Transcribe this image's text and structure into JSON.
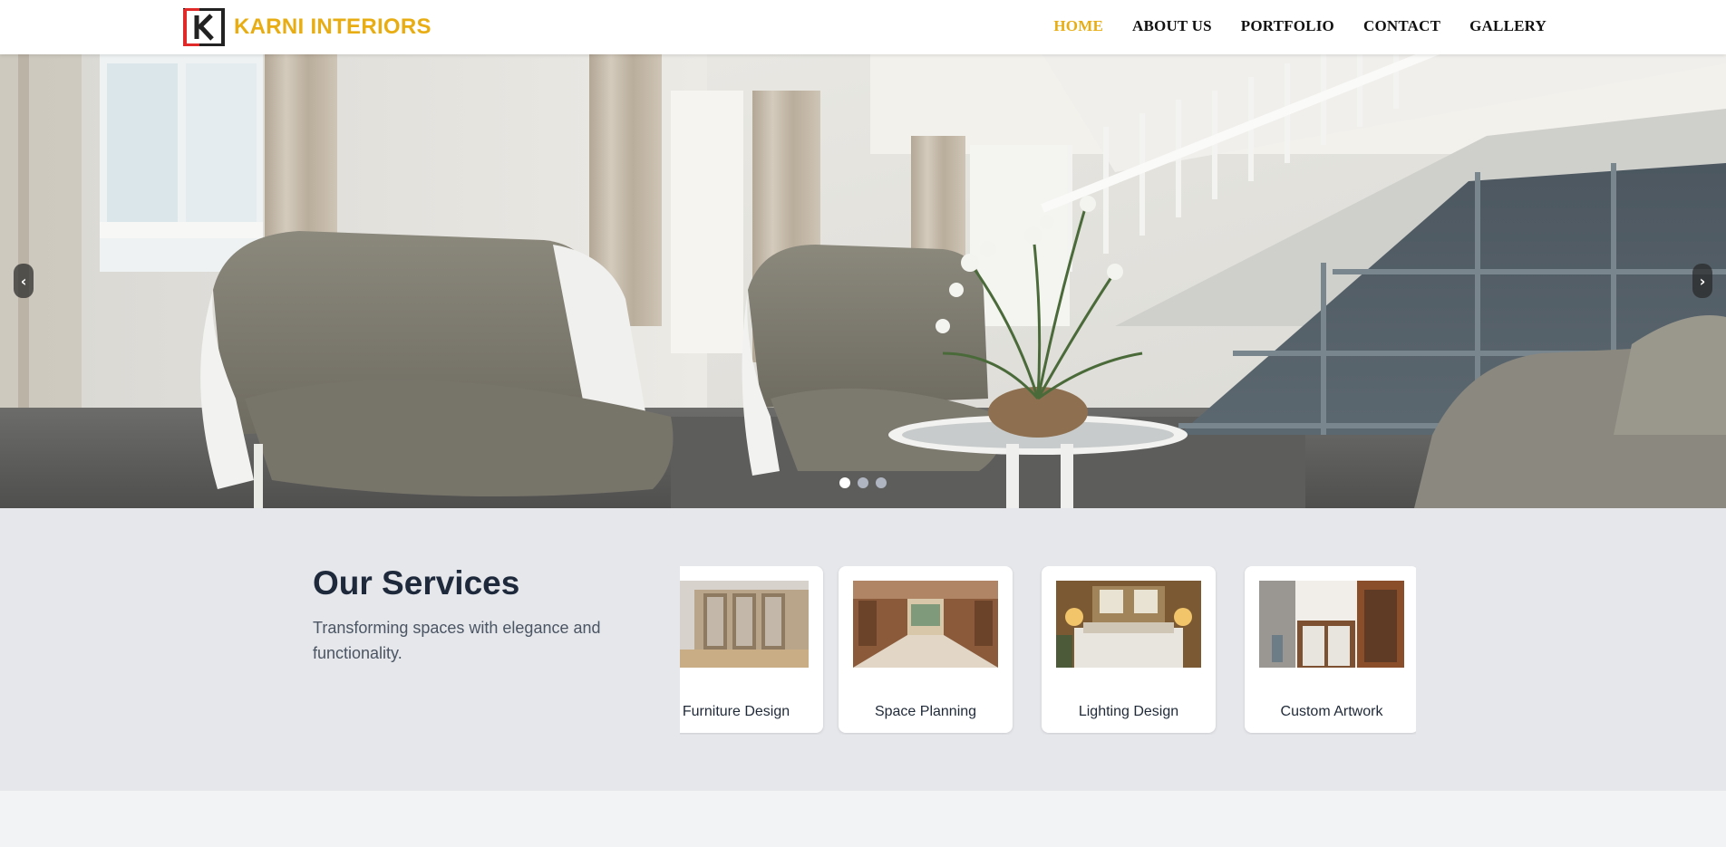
{
  "brand": {
    "name": "KARNI INTERIORS",
    "logo_icon": "k-logo-icon"
  },
  "nav": {
    "items": [
      {
        "label": "HOME",
        "active": true
      },
      {
        "label": "ABOUT US",
        "active": false
      },
      {
        "label": "PORTFOLIO",
        "active": false
      },
      {
        "label": "CONTACT",
        "active": false
      },
      {
        "label": "GALLERY",
        "active": false
      }
    ]
  },
  "hero": {
    "prev_label": "‹",
    "next_label": "›",
    "slide_count": 3,
    "active_slide": 1
  },
  "services": {
    "title": "Our Services",
    "subtitle": "Transforming spaces with elegance and functionality.",
    "cards": [
      {
        "label": "Furniture Design"
      },
      {
        "label": "Space Planning"
      },
      {
        "label": "Lighting Design"
      },
      {
        "label": "Custom Artwork"
      }
    ]
  },
  "colors": {
    "accent": "#e8ad13",
    "text_dark": "#1e293b",
    "services_bg": "#e5e7eb"
  }
}
